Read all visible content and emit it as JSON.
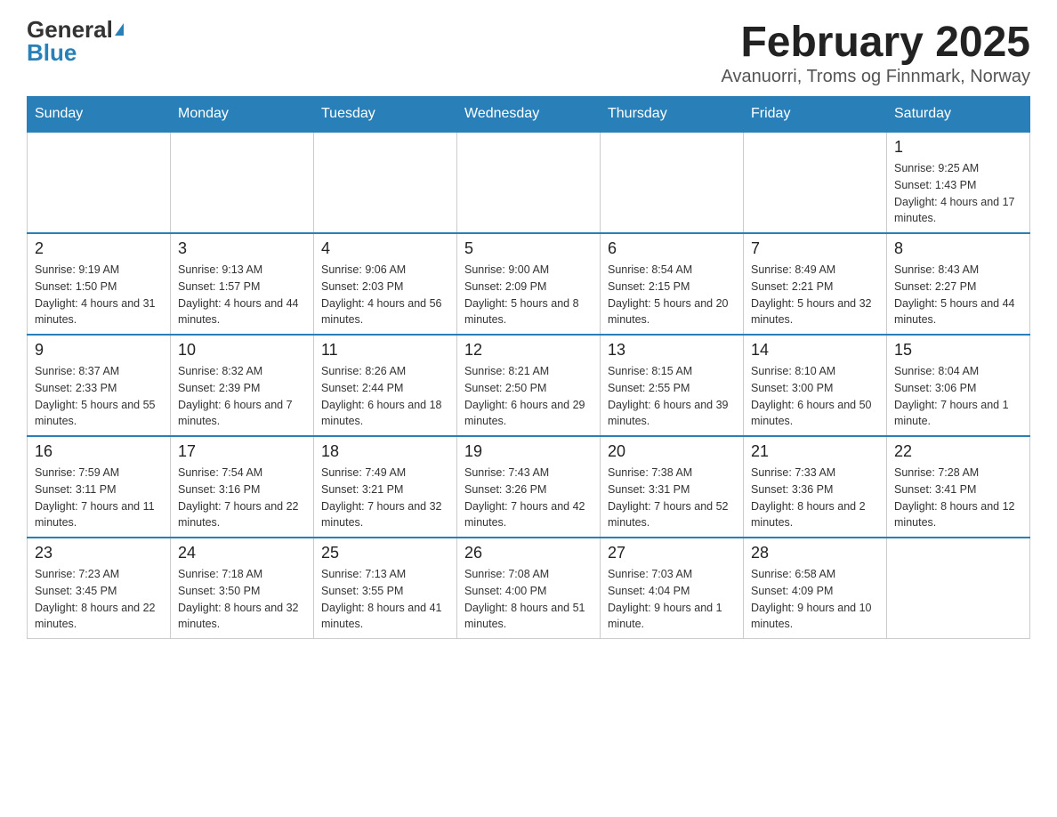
{
  "header": {
    "logo_general": "General",
    "logo_blue": "Blue",
    "month_title": "February 2025",
    "location": "Avanuorri, Troms og Finnmark, Norway"
  },
  "days_of_week": [
    "Sunday",
    "Monday",
    "Tuesday",
    "Wednesday",
    "Thursday",
    "Friday",
    "Saturday"
  ],
  "weeks": [
    [
      {
        "day": "",
        "sunrise": "",
        "sunset": "",
        "daylight": ""
      },
      {
        "day": "",
        "sunrise": "",
        "sunset": "",
        "daylight": ""
      },
      {
        "day": "",
        "sunrise": "",
        "sunset": "",
        "daylight": ""
      },
      {
        "day": "",
        "sunrise": "",
        "sunset": "",
        "daylight": ""
      },
      {
        "day": "",
        "sunrise": "",
        "sunset": "",
        "daylight": ""
      },
      {
        "day": "",
        "sunrise": "",
        "sunset": "",
        "daylight": ""
      },
      {
        "day": "1",
        "sunrise": "Sunrise: 9:25 AM",
        "sunset": "Sunset: 1:43 PM",
        "daylight": "Daylight: 4 hours and 17 minutes."
      }
    ],
    [
      {
        "day": "2",
        "sunrise": "Sunrise: 9:19 AM",
        "sunset": "Sunset: 1:50 PM",
        "daylight": "Daylight: 4 hours and 31 minutes."
      },
      {
        "day": "3",
        "sunrise": "Sunrise: 9:13 AM",
        "sunset": "Sunset: 1:57 PM",
        "daylight": "Daylight: 4 hours and 44 minutes."
      },
      {
        "day": "4",
        "sunrise": "Sunrise: 9:06 AM",
        "sunset": "Sunset: 2:03 PM",
        "daylight": "Daylight: 4 hours and 56 minutes."
      },
      {
        "day": "5",
        "sunrise": "Sunrise: 9:00 AM",
        "sunset": "Sunset: 2:09 PM",
        "daylight": "Daylight: 5 hours and 8 minutes."
      },
      {
        "day": "6",
        "sunrise": "Sunrise: 8:54 AM",
        "sunset": "Sunset: 2:15 PM",
        "daylight": "Daylight: 5 hours and 20 minutes."
      },
      {
        "day": "7",
        "sunrise": "Sunrise: 8:49 AM",
        "sunset": "Sunset: 2:21 PM",
        "daylight": "Daylight: 5 hours and 32 minutes."
      },
      {
        "day": "8",
        "sunrise": "Sunrise: 8:43 AM",
        "sunset": "Sunset: 2:27 PM",
        "daylight": "Daylight: 5 hours and 44 minutes."
      }
    ],
    [
      {
        "day": "9",
        "sunrise": "Sunrise: 8:37 AM",
        "sunset": "Sunset: 2:33 PM",
        "daylight": "Daylight: 5 hours and 55 minutes."
      },
      {
        "day": "10",
        "sunrise": "Sunrise: 8:32 AM",
        "sunset": "Sunset: 2:39 PM",
        "daylight": "Daylight: 6 hours and 7 minutes."
      },
      {
        "day": "11",
        "sunrise": "Sunrise: 8:26 AM",
        "sunset": "Sunset: 2:44 PM",
        "daylight": "Daylight: 6 hours and 18 minutes."
      },
      {
        "day": "12",
        "sunrise": "Sunrise: 8:21 AM",
        "sunset": "Sunset: 2:50 PM",
        "daylight": "Daylight: 6 hours and 29 minutes."
      },
      {
        "day": "13",
        "sunrise": "Sunrise: 8:15 AM",
        "sunset": "Sunset: 2:55 PM",
        "daylight": "Daylight: 6 hours and 39 minutes."
      },
      {
        "day": "14",
        "sunrise": "Sunrise: 8:10 AM",
        "sunset": "Sunset: 3:00 PM",
        "daylight": "Daylight: 6 hours and 50 minutes."
      },
      {
        "day": "15",
        "sunrise": "Sunrise: 8:04 AM",
        "sunset": "Sunset: 3:06 PM",
        "daylight": "Daylight: 7 hours and 1 minute."
      }
    ],
    [
      {
        "day": "16",
        "sunrise": "Sunrise: 7:59 AM",
        "sunset": "Sunset: 3:11 PM",
        "daylight": "Daylight: 7 hours and 11 minutes."
      },
      {
        "day": "17",
        "sunrise": "Sunrise: 7:54 AM",
        "sunset": "Sunset: 3:16 PM",
        "daylight": "Daylight: 7 hours and 22 minutes."
      },
      {
        "day": "18",
        "sunrise": "Sunrise: 7:49 AM",
        "sunset": "Sunset: 3:21 PM",
        "daylight": "Daylight: 7 hours and 32 minutes."
      },
      {
        "day": "19",
        "sunrise": "Sunrise: 7:43 AM",
        "sunset": "Sunset: 3:26 PM",
        "daylight": "Daylight: 7 hours and 42 minutes."
      },
      {
        "day": "20",
        "sunrise": "Sunrise: 7:38 AM",
        "sunset": "Sunset: 3:31 PM",
        "daylight": "Daylight: 7 hours and 52 minutes."
      },
      {
        "day": "21",
        "sunrise": "Sunrise: 7:33 AM",
        "sunset": "Sunset: 3:36 PM",
        "daylight": "Daylight: 8 hours and 2 minutes."
      },
      {
        "day": "22",
        "sunrise": "Sunrise: 7:28 AM",
        "sunset": "Sunset: 3:41 PM",
        "daylight": "Daylight: 8 hours and 12 minutes."
      }
    ],
    [
      {
        "day": "23",
        "sunrise": "Sunrise: 7:23 AM",
        "sunset": "Sunset: 3:45 PM",
        "daylight": "Daylight: 8 hours and 22 minutes."
      },
      {
        "day": "24",
        "sunrise": "Sunrise: 7:18 AM",
        "sunset": "Sunset: 3:50 PM",
        "daylight": "Daylight: 8 hours and 32 minutes."
      },
      {
        "day": "25",
        "sunrise": "Sunrise: 7:13 AM",
        "sunset": "Sunset: 3:55 PM",
        "daylight": "Daylight: 8 hours and 41 minutes."
      },
      {
        "day": "26",
        "sunrise": "Sunrise: 7:08 AM",
        "sunset": "Sunset: 4:00 PM",
        "daylight": "Daylight: 8 hours and 51 minutes."
      },
      {
        "day": "27",
        "sunrise": "Sunrise: 7:03 AM",
        "sunset": "Sunset: 4:04 PM",
        "daylight": "Daylight: 9 hours and 1 minute."
      },
      {
        "day": "28",
        "sunrise": "Sunrise: 6:58 AM",
        "sunset": "Sunset: 4:09 PM",
        "daylight": "Daylight: 9 hours and 10 minutes."
      },
      {
        "day": "",
        "sunrise": "",
        "sunset": "",
        "daylight": ""
      }
    ]
  ]
}
